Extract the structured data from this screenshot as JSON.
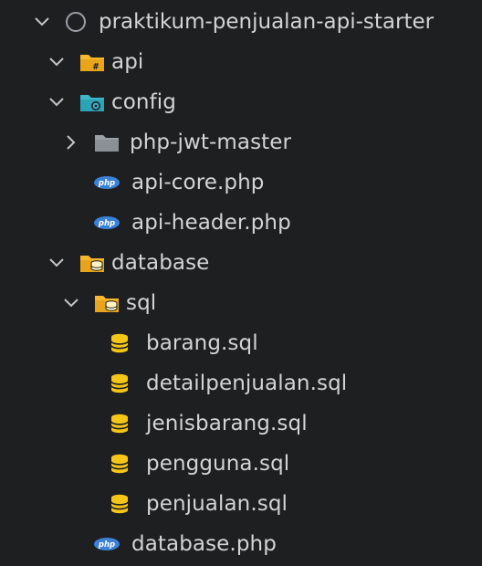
{
  "explorer": {
    "root": {
      "label": "praktikum-penjualan-api-starter",
      "icon": "circle-outline-icon",
      "expanded": true
    },
    "items": [
      {
        "label": "api",
        "icon": "folder-api-icon",
        "expanded": true
      },
      {
        "label": "config",
        "icon": "folder-config-icon",
        "expanded": true
      },
      {
        "label": "php-jwt-master",
        "icon": "folder-icon",
        "expanded": false
      },
      {
        "label": "api-core.php",
        "icon": "php-file-icon"
      },
      {
        "label": "api-header.php",
        "icon": "php-file-icon"
      },
      {
        "label": "database",
        "icon": "folder-database-icon",
        "expanded": true
      },
      {
        "label": "sql",
        "icon": "folder-database-icon",
        "expanded": true
      },
      {
        "label": "barang.sql",
        "icon": "database-icon"
      },
      {
        "label": "detailpenjualan.sql",
        "icon": "database-icon"
      },
      {
        "label": "jenisbarang.sql",
        "icon": "database-icon"
      },
      {
        "label": "pengguna.sql",
        "icon": "database-icon"
      },
      {
        "label": "penjualan.sql",
        "icon": "database-icon"
      },
      {
        "label": "database.php",
        "icon": "php-file-icon"
      }
    ]
  },
  "colors": {
    "background": "#1e1f21",
    "text": "#d4d4d4",
    "chevron": "#c5c5c5",
    "folder_yellow": "#f5b82e",
    "folder_gray": "#9aa0a6",
    "config_teal": "#3fb6c9",
    "php_blue": "#3b82d6",
    "database_yellow": "#f5c518"
  }
}
